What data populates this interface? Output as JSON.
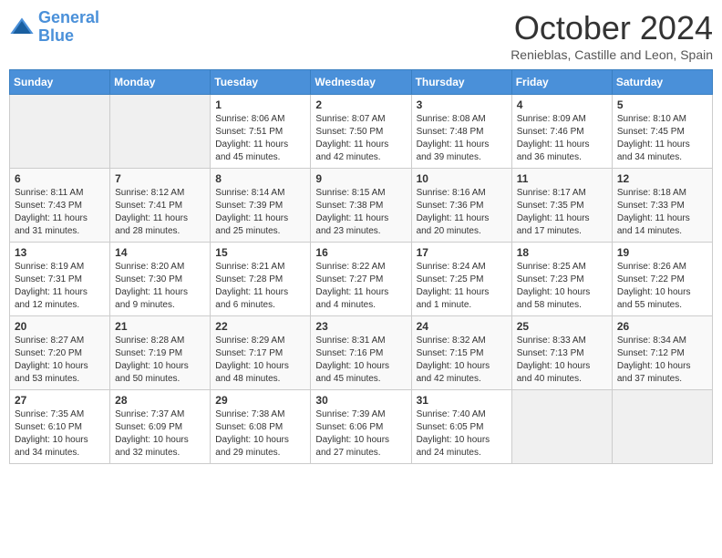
{
  "header": {
    "logo_line1": "General",
    "logo_line2": "Blue",
    "month": "October 2024",
    "location": "Renieblas, Castille and Leon, Spain"
  },
  "days_of_week": [
    "Sunday",
    "Monday",
    "Tuesday",
    "Wednesday",
    "Thursday",
    "Friday",
    "Saturday"
  ],
  "weeks": [
    [
      {
        "day": "",
        "info": ""
      },
      {
        "day": "",
        "info": ""
      },
      {
        "day": "1",
        "info": "Sunrise: 8:06 AM\nSunset: 7:51 PM\nDaylight: 11 hours and 45 minutes."
      },
      {
        "day": "2",
        "info": "Sunrise: 8:07 AM\nSunset: 7:50 PM\nDaylight: 11 hours and 42 minutes."
      },
      {
        "day": "3",
        "info": "Sunrise: 8:08 AM\nSunset: 7:48 PM\nDaylight: 11 hours and 39 minutes."
      },
      {
        "day": "4",
        "info": "Sunrise: 8:09 AM\nSunset: 7:46 PM\nDaylight: 11 hours and 36 minutes."
      },
      {
        "day": "5",
        "info": "Sunrise: 8:10 AM\nSunset: 7:45 PM\nDaylight: 11 hours and 34 minutes."
      }
    ],
    [
      {
        "day": "6",
        "info": "Sunrise: 8:11 AM\nSunset: 7:43 PM\nDaylight: 11 hours and 31 minutes."
      },
      {
        "day": "7",
        "info": "Sunrise: 8:12 AM\nSunset: 7:41 PM\nDaylight: 11 hours and 28 minutes."
      },
      {
        "day": "8",
        "info": "Sunrise: 8:14 AM\nSunset: 7:39 PM\nDaylight: 11 hours and 25 minutes."
      },
      {
        "day": "9",
        "info": "Sunrise: 8:15 AM\nSunset: 7:38 PM\nDaylight: 11 hours and 23 minutes."
      },
      {
        "day": "10",
        "info": "Sunrise: 8:16 AM\nSunset: 7:36 PM\nDaylight: 11 hours and 20 minutes."
      },
      {
        "day": "11",
        "info": "Sunrise: 8:17 AM\nSunset: 7:35 PM\nDaylight: 11 hours and 17 minutes."
      },
      {
        "day": "12",
        "info": "Sunrise: 8:18 AM\nSunset: 7:33 PM\nDaylight: 11 hours and 14 minutes."
      }
    ],
    [
      {
        "day": "13",
        "info": "Sunrise: 8:19 AM\nSunset: 7:31 PM\nDaylight: 11 hours and 12 minutes."
      },
      {
        "day": "14",
        "info": "Sunrise: 8:20 AM\nSunset: 7:30 PM\nDaylight: 11 hours and 9 minutes."
      },
      {
        "day": "15",
        "info": "Sunrise: 8:21 AM\nSunset: 7:28 PM\nDaylight: 11 hours and 6 minutes."
      },
      {
        "day": "16",
        "info": "Sunrise: 8:22 AM\nSunset: 7:27 PM\nDaylight: 11 hours and 4 minutes."
      },
      {
        "day": "17",
        "info": "Sunrise: 8:24 AM\nSunset: 7:25 PM\nDaylight: 11 hours and 1 minute."
      },
      {
        "day": "18",
        "info": "Sunrise: 8:25 AM\nSunset: 7:23 PM\nDaylight: 10 hours and 58 minutes."
      },
      {
        "day": "19",
        "info": "Sunrise: 8:26 AM\nSunset: 7:22 PM\nDaylight: 10 hours and 55 minutes."
      }
    ],
    [
      {
        "day": "20",
        "info": "Sunrise: 8:27 AM\nSunset: 7:20 PM\nDaylight: 10 hours and 53 minutes."
      },
      {
        "day": "21",
        "info": "Sunrise: 8:28 AM\nSunset: 7:19 PM\nDaylight: 10 hours and 50 minutes."
      },
      {
        "day": "22",
        "info": "Sunrise: 8:29 AM\nSunset: 7:17 PM\nDaylight: 10 hours and 48 minutes."
      },
      {
        "day": "23",
        "info": "Sunrise: 8:31 AM\nSunset: 7:16 PM\nDaylight: 10 hours and 45 minutes."
      },
      {
        "day": "24",
        "info": "Sunrise: 8:32 AM\nSunset: 7:15 PM\nDaylight: 10 hours and 42 minutes."
      },
      {
        "day": "25",
        "info": "Sunrise: 8:33 AM\nSunset: 7:13 PM\nDaylight: 10 hours and 40 minutes."
      },
      {
        "day": "26",
        "info": "Sunrise: 8:34 AM\nSunset: 7:12 PM\nDaylight: 10 hours and 37 minutes."
      }
    ],
    [
      {
        "day": "27",
        "info": "Sunrise: 7:35 AM\nSunset: 6:10 PM\nDaylight: 10 hours and 34 minutes."
      },
      {
        "day": "28",
        "info": "Sunrise: 7:37 AM\nSunset: 6:09 PM\nDaylight: 10 hours and 32 minutes."
      },
      {
        "day": "29",
        "info": "Sunrise: 7:38 AM\nSunset: 6:08 PM\nDaylight: 10 hours and 29 minutes."
      },
      {
        "day": "30",
        "info": "Sunrise: 7:39 AM\nSunset: 6:06 PM\nDaylight: 10 hours and 27 minutes."
      },
      {
        "day": "31",
        "info": "Sunrise: 7:40 AM\nSunset: 6:05 PM\nDaylight: 10 hours and 24 minutes."
      },
      {
        "day": "",
        "info": ""
      },
      {
        "day": "",
        "info": ""
      }
    ]
  ]
}
